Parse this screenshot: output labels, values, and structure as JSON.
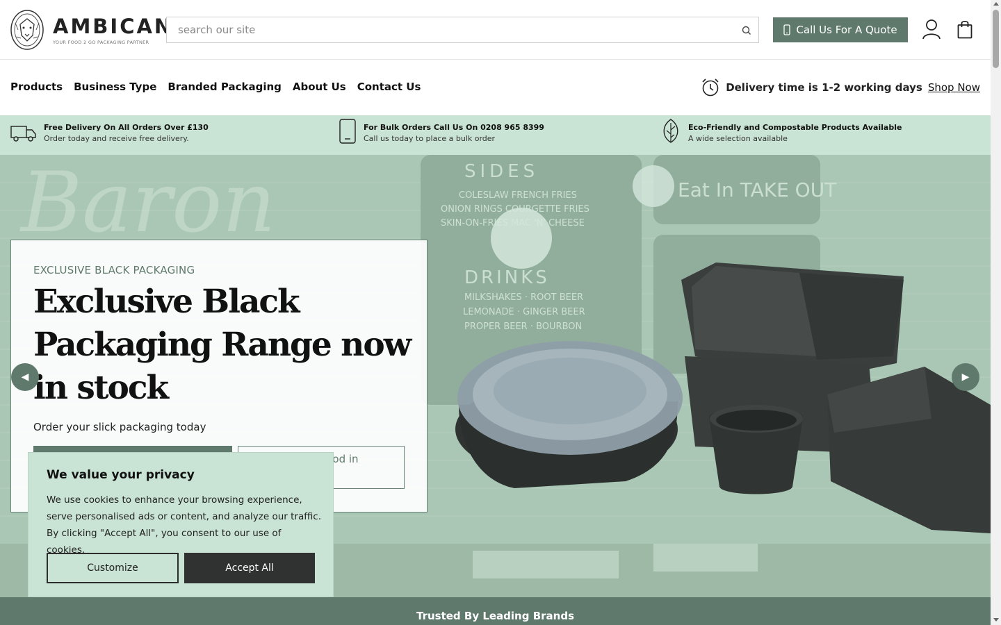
{
  "header": {
    "logo_name": "AMBICAN",
    "logo_tagline": "YOUR FOOD 2 GO PACKAGING PARTNER",
    "search_placeholder": "search our site",
    "quote_label": "Call Us For A Quote"
  },
  "nav": {
    "items": [
      "Products",
      "Business Type",
      "Branded Packaging",
      "About Us",
      "Contact Us"
    ],
    "delivery_text": "Delivery time is 1-2 working days",
    "shop_now": "Shop Now"
  },
  "benefits": [
    {
      "title": "Free Delivery On All Orders Over £130",
      "subtitle": "Order today and receive free delivery.",
      "icon": "truck-icon"
    },
    {
      "title": "For Bulk Orders Call Us On 0208 965 8399",
      "subtitle": "Call us today to place a bulk order",
      "icon": "phone-icon"
    },
    {
      "title": "Eco-Friendly and Compostable Products Available",
      "subtitle": "A wide selection available",
      "icon": "leaf-icon"
    }
  ],
  "hero": {
    "eyebrow": "EXCLUSIVE BLACK PACKAGING",
    "title": "Exclusive Black Packaging Range now in stock",
    "subtitle": "Order your slick packaging today",
    "secondary_button": "r food in\ng",
    "background_board": {
      "sides_heading": "SIDES",
      "sides_lines": [
        "COLESLAW   FRENCH FRIES",
        "ONION RINGS  COURGETTE FRIES",
        "SKIN-ON-FRIES  MAC 'N' CHEESE"
      ],
      "drinks_heading": "DRINKS",
      "drinks_lines": [
        "MILKSHAKES · ROOT BEER",
        "LEMONADE · GINGER BEER",
        "PROPER BEER · BOURBON"
      ],
      "wall_script": "Baron",
      "right_board": "Eat In TAKE OUT"
    },
    "prev_arrow": "◀",
    "next_arrow": "▶"
  },
  "trusted": {
    "label": "Trusted By Leading Brands"
  },
  "cookie": {
    "title": "We value your privacy",
    "text": "We use cookies to enhance your browsing experience, serve personalised ads or content, and analyze our traffic. By clicking \"Accept All\", you consent to our use of cookies.",
    "customize_label": "Customize",
    "accept_label": "Accept All"
  },
  "colors": {
    "brand_green": "#5f7a6c",
    "mint": "#c9e3d4",
    "dark_button": "#2f3230"
  }
}
